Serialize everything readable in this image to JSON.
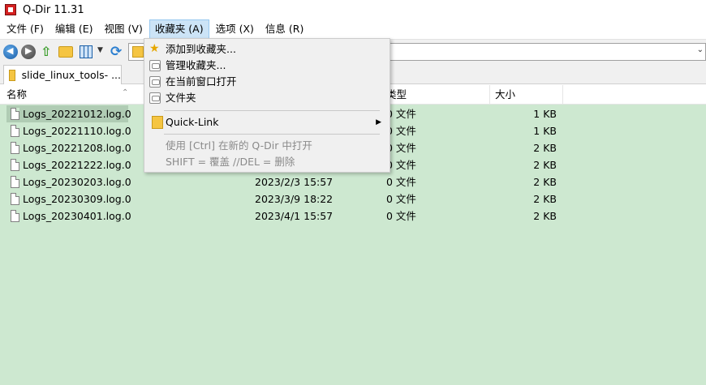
{
  "window": {
    "title": "Q-Dir 11.31"
  },
  "menubar": {
    "items": [
      "文件 (F)",
      "编辑 (E)",
      "视图 (V)",
      "收藏夹 (A)",
      "选项 (X)",
      "信息 (R)"
    ]
  },
  "tab": {
    "label": "slide_linux_tools- ..."
  },
  "columns": {
    "name": "名称",
    "date": "",
    "type": "类型",
    "size": "大小"
  },
  "files": [
    {
      "name": "Logs_20221012.log.0",
      "date": "",
      "type": "0 文件",
      "size": "1 KB"
    },
    {
      "name": "Logs_20221110.log.0",
      "date": "",
      "type": "0 文件",
      "size": "1 KB"
    },
    {
      "name": "Logs_20221208.log.0",
      "date": "",
      "type": "0 文件",
      "size": "2 KB"
    },
    {
      "name": "Logs_20221222.log.0",
      "date": "",
      "type": "0 文件",
      "size": "2 KB"
    },
    {
      "name": "Logs_20230203.log.0",
      "date": "2023/2/3 15:57",
      "type": "0 文件",
      "size": "2 KB"
    },
    {
      "name": "Logs_20230309.log.0",
      "date": "2023/3/9 18:22",
      "type": "0 文件",
      "size": "2 KB"
    },
    {
      "name": "Logs_20230401.log.0",
      "date": "2023/4/1 15:57",
      "type": "0 文件",
      "size": "2 KB"
    }
  ],
  "favorites_menu": {
    "add": "添加到收藏夹...",
    "manage": "管理收藏夹...",
    "open_current": "在当前窗口打开",
    "folder": "文件夹",
    "quick_link": "Quick-Link",
    "hint1": "使用 [Ctrl] 在新的 Q-Dir 中打开",
    "hint2": "SHIFT = 覆盖 //DEL = 删除"
  },
  "colors": {
    "list_bg": "#cde8d0",
    "menu_open_bg": "#cce4f7",
    "selected_row": "#b0ccb4"
  }
}
